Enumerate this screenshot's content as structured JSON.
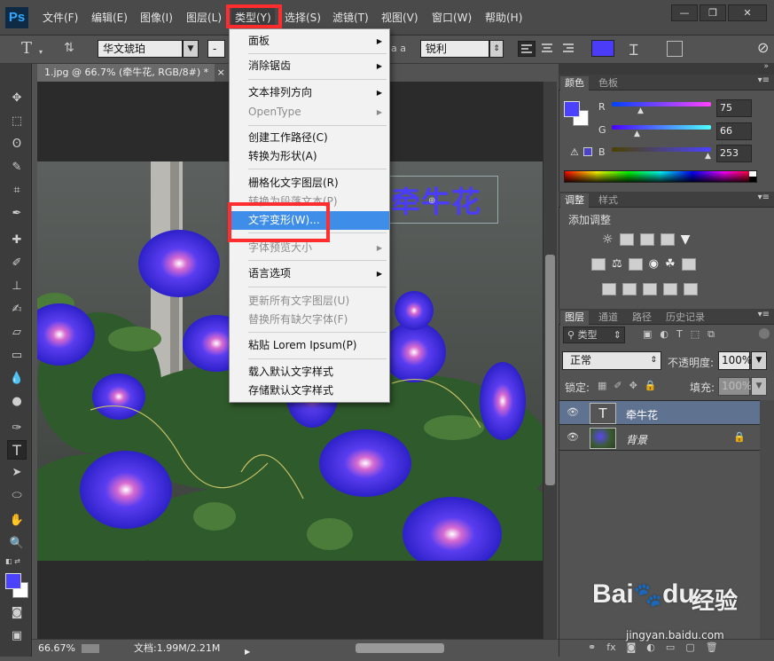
{
  "menubar": {
    "logo": "Ps",
    "items": [
      "文件(F)",
      "编辑(E)",
      "图像(I)",
      "图层(L)",
      "类型(Y)",
      "选择(S)",
      "滤镜(T)",
      "视图(V)",
      "窗口(W)",
      "帮助(H)"
    ],
    "active_index": 4
  },
  "window_buttons": {
    "minimize": "—",
    "restore": "❐",
    "close": "✕"
  },
  "options": {
    "tool_icon": "T",
    "font_family": "华文琥珀",
    "font_size_hint": "-",
    "aa_icon": "a a",
    "antialias": "锐利",
    "text_color": "#4b3cf7"
  },
  "document": {
    "tab_title": "1.jpg @ 66.7% (牵牛花, RGB/8#) *",
    "tab_close": "×",
    "text_layer_content": "牵牛花",
    "status_zoom": "66.67%",
    "status_doc": "文档:1.99M/2.21M"
  },
  "type_menu": {
    "items": [
      {
        "label": "面板",
        "disabled": false,
        "submenu": true
      },
      {
        "label": "消除锯齿",
        "disabled": false,
        "submenu": true
      },
      {
        "label": "文本排列方向",
        "disabled": false,
        "submenu": true
      },
      {
        "label": "OpenType",
        "disabled": true,
        "submenu": true
      },
      {
        "label": "创建工作路径(C)",
        "disabled": false,
        "submenu": false
      },
      {
        "label": "转换为形状(A)",
        "disabled": false,
        "submenu": false
      },
      {
        "label": "栅格化文字图层(R)",
        "disabled": false,
        "submenu": false
      },
      {
        "label": "转换为段落文本(P)",
        "disabled": true,
        "submenu": false
      },
      {
        "label": "文字变形(W)...",
        "disabled": false,
        "submenu": false,
        "highlighted": true
      },
      {
        "label": "字体预览大小",
        "disabled": true,
        "submenu": true
      },
      {
        "label": "语言选项",
        "disabled": false,
        "submenu": true
      },
      {
        "label": "更新所有文字图层(U)",
        "disabled": true,
        "submenu": false
      },
      {
        "label": "替换所有缺欠字体(F)",
        "disabled": true,
        "submenu": false
      },
      {
        "label": "粘贴 Lorem Ipsum(P)",
        "disabled": false,
        "submenu": false
      },
      {
        "label": "载入默认文字样式",
        "disabled": false,
        "submenu": false
      },
      {
        "label": "存储默认文字样式",
        "disabled": false,
        "submenu": false
      }
    ]
  },
  "color_panel": {
    "tabs": [
      "颜色",
      "色板"
    ],
    "r_label": "R",
    "g_label": "G",
    "b_label": "B",
    "r": "75",
    "g": "66",
    "b": "253",
    "foreground": "#4b42fd"
  },
  "adjust_panel": {
    "tabs": [
      "调整",
      "样式"
    ],
    "title": "添加调整"
  },
  "layers_panel": {
    "tabs": [
      "图层",
      "通道",
      "路径",
      "历史记录"
    ],
    "filter_label": "类型",
    "blend_mode": "正常",
    "opacity_label": "不透明度:",
    "opacity": "100%",
    "lock_label": "锁定:",
    "fill_label": "填充:",
    "fill": "100%",
    "layers": [
      {
        "name": "牵牛花",
        "thumb": "T",
        "selected": true
      },
      {
        "name": "背景",
        "thumb": "",
        "selected": false,
        "locked": true
      }
    ]
  },
  "watermark": {
    "brand": "Bai",
    "brand2": "du",
    "cn": "经验",
    "url": "jingyan.baidu.com"
  }
}
